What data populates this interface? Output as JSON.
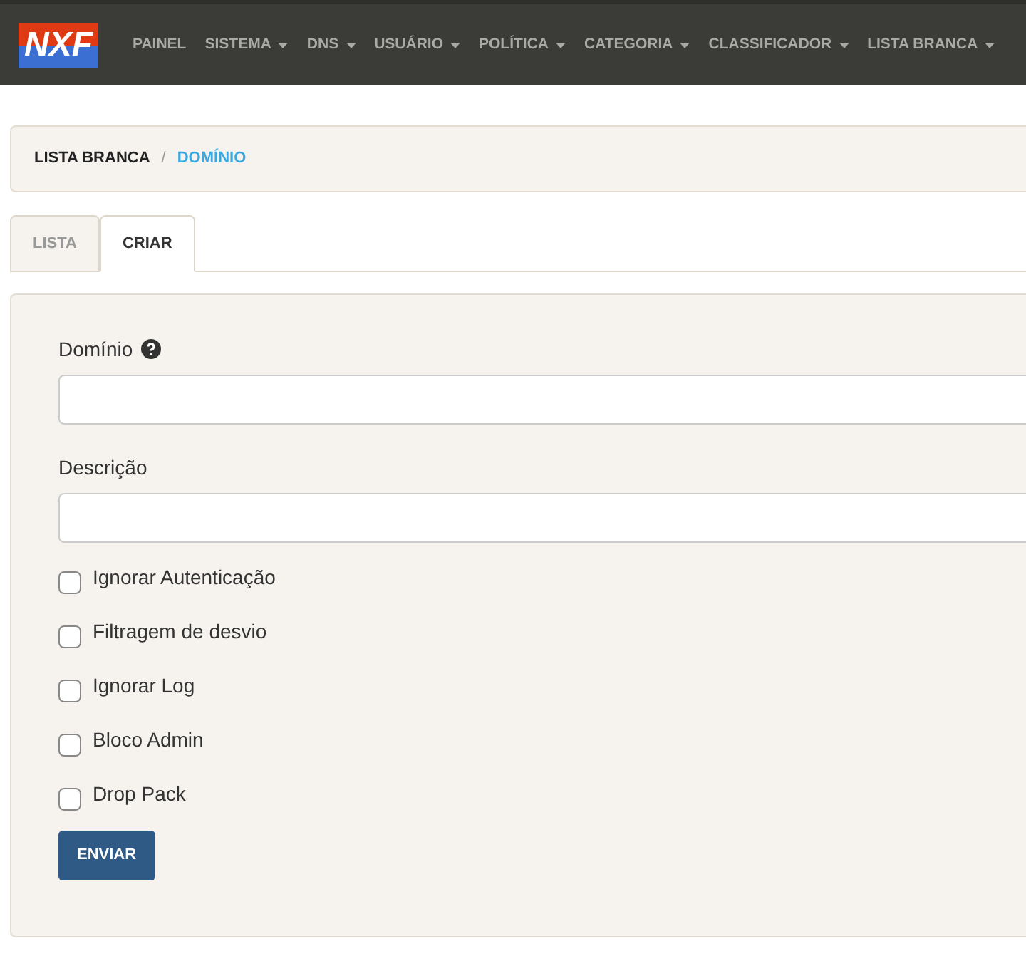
{
  "navbar": {
    "logo": "NXF",
    "items": [
      {
        "label": "PAINEL",
        "dropdown": false
      },
      {
        "label": "SISTEMA",
        "dropdown": true
      },
      {
        "label": "DNS",
        "dropdown": true
      },
      {
        "label": "USUÁRIO",
        "dropdown": true
      },
      {
        "label": "POLÍTICA",
        "dropdown": true
      },
      {
        "label": "CATEGORIA",
        "dropdown": true
      },
      {
        "label": "CLASSIFICADOR",
        "dropdown": true
      },
      {
        "label": "LISTA BRANCA",
        "dropdown": true
      }
    ]
  },
  "breadcrumb": {
    "separator": "/",
    "items": [
      {
        "label": "LISTA BRANCA",
        "current": false
      },
      {
        "label": "DOMÍNIO",
        "current": true
      }
    ]
  },
  "tabs": [
    {
      "label": "LISTA",
      "selected": false
    },
    {
      "label": "CRIAR",
      "selected": true
    }
  ],
  "form": {
    "fields": [
      {
        "label": "Domínio",
        "help": true
      },
      {
        "label": "Descrição",
        "help": false
      }
    ],
    "checkboxes": [
      {
        "label": "Ignorar Autenticação",
        "checked": false
      },
      {
        "label": "Filtragem de desvio",
        "checked": false
      },
      {
        "label": "Ignorar Log",
        "checked": false
      },
      {
        "label": "Bloco Admin",
        "checked": false
      },
      {
        "label": "Drop Pack",
        "checked": false
      }
    ],
    "submit": "ENVIAR"
  }
}
